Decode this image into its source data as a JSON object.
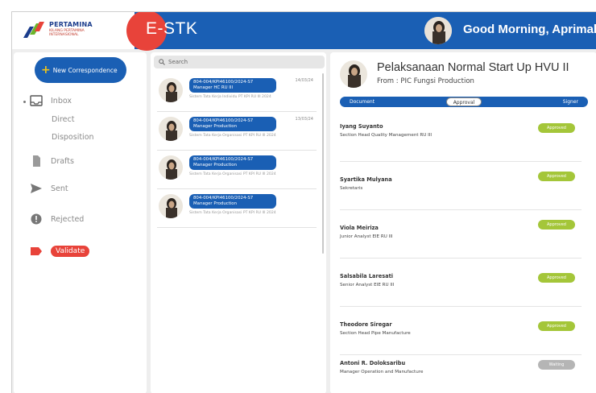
{
  "header": {
    "logo_name": "PERTAMINA",
    "logo_sub": "KILANG PERTAMINA INTERNASIONAL",
    "app_title": "E-STK",
    "greeting": "Good Morning, Aprimal",
    "accent_color": "#1a5fb4",
    "brand_red": "#e8433a"
  },
  "sidebar": {
    "new_button": "New Correspondence",
    "items": [
      {
        "label": "Inbox",
        "icon": "inbox-icon"
      },
      {
        "label": "Direct"
      },
      {
        "label": "Disposition"
      },
      {
        "label": "Drafts",
        "icon": "file-icon"
      },
      {
        "label": "Sent",
        "icon": "send-icon"
      },
      {
        "label": "Rejected",
        "icon": "alert-icon"
      },
      {
        "label": "Validate",
        "icon": "tag-icon"
      }
    ]
  },
  "list": {
    "search_placeholder": "Search",
    "items": [
      {
        "number": "804-004/KPI46100/2024-S7",
        "sender": "Manager HC RU III",
        "date": "14/03/24",
        "subject": "Sistem Tata Kerja Individu PT KPI RU III 2024"
      },
      {
        "number": "804-004/KPI46100/2024-S7",
        "sender": "Manager Production",
        "date": "13/03/24",
        "subject": "Sistem Tata Kerja Organisasi PT KPI RU III 2024"
      },
      {
        "number": "804-004/KPI46100/2024-S7",
        "sender": "Manager Production",
        "date": "",
        "subject": "Sistem Tata Kerja Organisasi PT KPI RU III 2024"
      },
      {
        "number": "804-004/KPI46100/2024-S7",
        "sender": "Manager Production",
        "date": "",
        "subject": "Sistem Tata Kerja Organisasi PT KPI RU III 2024"
      }
    ]
  },
  "detail": {
    "title": "Pelaksanaan Normal Start Up HVU II",
    "from": "From : PIC Fungsi Production",
    "tabs": [
      "Document",
      "Approval",
      "Signer"
    ],
    "active_tab": "Approval",
    "approvals": [
      {
        "name": "Iyang Suyanto",
        "role": "Section Head Quality Management RU III",
        "status": "Approved"
      },
      {
        "name": "Syartika Mulyana",
        "role": "Sekretaris",
        "status": "Approved"
      },
      {
        "name": "Viola Meiriza",
        "role": "Junior Analyst EIE RU III",
        "status": "Approved"
      },
      {
        "name": "Salsabila Laresati",
        "role": "Senior Analyst EIE RU III",
        "status": "Approved"
      },
      {
        "name": "Theodore Siregar",
        "role": "Section Head Pipe Manufacture",
        "status": "Approved"
      },
      {
        "name": "Antoni R. Doloksaribu",
        "role": "Manager Operation and Manufacture",
        "status": "Waiting"
      }
    ]
  }
}
